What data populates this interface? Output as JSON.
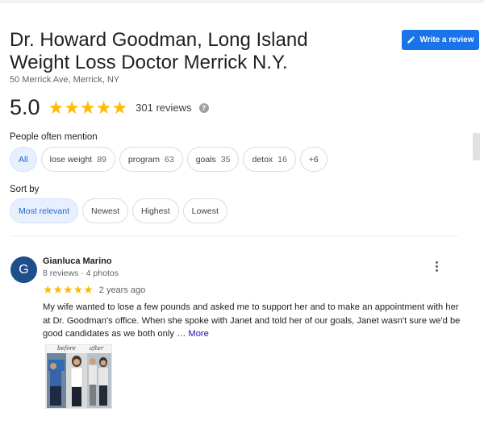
{
  "business": {
    "title_line1": "Dr. Howard Goodman, Long Island",
    "title_line2": "Weight Loss Doctor Merrick N.Y.",
    "address": "50 Merrick Ave, Merrick, NY"
  },
  "actions": {
    "write_review": "Write a review"
  },
  "rating": {
    "score": "5.0",
    "stars": "★★★★★",
    "reviews": "301 reviews",
    "help_glyph": "?"
  },
  "mentions": {
    "label": "People often mention",
    "chips": [
      {
        "label": "All",
        "count": ""
      },
      {
        "label": "lose weight",
        "count": "89"
      },
      {
        "label": "program",
        "count": "63"
      },
      {
        "label": "goals",
        "count": "35"
      },
      {
        "label": "detox",
        "count": "16"
      },
      {
        "label": "+6",
        "count": ""
      }
    ]
  },
  "sort": {
    "label": "Sort by",
    "options": [
      "Most relevant",
      "Newest",
      "Highest",
      "Lowest"
    ]
  },
  "review": {
    "avatar_letter": "G",
    "name": "Gianluca Marino",
    "meta": "8 reviews · 4 photos",
    "stars": "★★★★★",
    "date": "2 years ago",
    "text": "My wife wanted to lose a few pounds and asked me to support her and to make an appointment with her at Dr. Goodman's office. When she spoke with Janet and told her of our goals, Janet wasn't sure we'd be good candidates as we both only … ",
    "more": "More",
    "photo_before": "before",
    "photo_after": "after"
  },
  "colors": {
    "accent": "#1a73e8",
    "star": "#fbbc04",
    "chip_active_bg": "#e8f0fe",
    "avatar_bg": "#1e4e8c"
  },
  "icons": {
    "write_review": "pencil-icon",
    "help": "help-icon",
    "menu": "more-vert-icon"
  }
}
